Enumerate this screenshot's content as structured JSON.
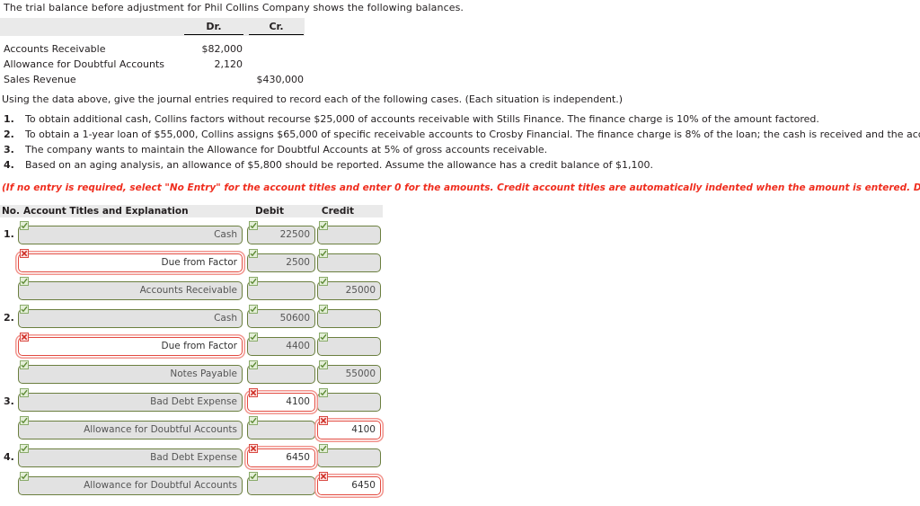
{
  "intro": {
    "line": "The trial balance before adjustment for Phil Collins Company shows the following balances."
  },
  "trial_balance": {
    "col_dr": "Dr.",
    "col_cr": "Cr.",
    "rows": [
      {
        "label": "Accounts Receivable",
        "dr": "$82,000",
        "cr": ""
      },
      {
        "label": "Allowance for Doubtful Accounts",
        "dr": "2,120",
        "cr": ""
      },
      {
        "label": "Sales Revenue",
        "dr": "",
        "cr": "$430,000"
      }
    ]
  },
  "instructions": {
    "lead": "Using the data above, give the journal entries required to record each of the following cases. (Each situation is independent.)",
    "cases": [
      {
        "no": "1.",
        "text": "To obtain additional cash, Collins factors without recourse $25,000 of accounts receivable with Stills Finance. The finance charge is 10% of the amount factored."
      },
      {
        "no": "2.",
        "text": "To obtain a 1-year loan of $55,000, Collins assigns $65,000 of specific receivable accounts to Crosby Financial. The finance charge is 8% of the loan; the cash is received and the accounts turned over to Crosby Financial."
      },
      {
        "no": "3.",
        "text": "The company wants to maintain the Allowance for Doubtful Accounts at 5% of gross accounts receivable."
      },
      {
        "no": "4.",
        "text": "Based on an aging analysis, an allowance of $5,800 should be reported. Assume the allowance has a credit balance of $1,100."
      }
    ],
    "red_note": "(If no entry is required, select \"No Entry\" for the account titles and enter 0 for the amounts. Credit account titles are automatically indented when the amount is entered. Do not indent manually.)",
    "red_color": "#ef2d1e"
  },
  "journal": {
    "headers": {
      "no": "No.",
      "account": "Account Titles and Explanation",
      "debit": "Debit",
      "credit": "Credit"
    },
    "rows": [
      {
        "no": "1.",
        "account": {
          "text": "Cash",
          "indent": false,
          "status": "ok"
        },
        "debit": {
          "text": "22500",
          "status": "ok"
        },
        "credit": {
          "text": "",
          "status": "ok"
        }
      },
      {
        "no": "",
        "account": {
          "text": "Due from Factor",
          "indent": false,
          "status": "bad"
        },
        "debit": {
          "text": "2500",
          "status": "ok"
        },
        "credit": {
          "text": "",
          "status": "ok"
        }
      },
      {
        "no": "",
        "account": {
          "text": "Accounts Receivable",
          "indent": true,
          "status": "ok"
        },
        "debit": {
          "text": "",
          "status": "ok"
        },
        "credit": {
          "text": "25000",
          "status": "ok"
        }
      },
      {
        "no": "2.",
        "account": {
          "text": "Cash",
          "indent": false,
          "status": "ok"
        },
        "debit": {
          "text": "50600",
          "status": "ok"
        },
        "credit": {
          "text": "",
          "status": "ok"
        }
      },
      {
        "no": "",
        "account": {
          "text": "Due from Factor",
          "indent": false,
          "status": "bad"
        },
        "debit": {
          "text": "4400",
          "status": "ok"
        },
        "credit": {
          "text": "",
          "status": "ok"
        }
      },
      {
        "no": "",
        "account": {
          "text": "Notes Payable",
          "indent": true,
          "status": "ok"
        },
        "debit": {
          "text": "",
          "status": "ok"
        },
        "credit": {
          "text": "55000",
          "status": "ok"
        }
      },
      {
        "no": "3.",
        "account": {
          "text": "Bad Debt Expense",
          "indent": false,
          "status": "ok"
        },
        "debit": {
          "text": "4100",
          "status": "bad"
        },
        "credit": {
          "text": "",
          "status": "ok"
        }
      },
      {
        "no": "",
        "account": {
          "text": "Allowance for Doubtful Accounts",
          "indent": true,
          "status": "ok"
        },
        "debit": {
          "text": "",
          "status": "ok"
        },
        "credit": {
          "text": "4100",
          "status": "bad"
        }
      },
      {
        "no": "4.",
        "account": {
          "text": "Bad Debt Expense",
          "indent": false,
          "status": "ok"
        },
        "debit": {
          "text": "6450",
          "status": "bad"
        },
        "credit": {
          "text": "",
          "status": "ok"
        }
      },
      {
        "no": "",
        "account": {
          "text": "Allowance for Doubtful Accounts",
          "indent": true,
          "status": "ok"
        },
        "debit": {
          "text": "",
          "status": "ok"
        },
        "credit": {
          "text": "6450",
          "status": "bad"
        }
      }
    ],
    "icons": {
      "ok": "check-icon",
      "bad": "cross-icon"
    },
    "colors": {
      "valid_border": "#6b7f3f",
      "invalid_border": "#e24a40",
      "field_fill": "#e2e2e2",
      "header_band": "#eaeaea"
    }
  }
}
